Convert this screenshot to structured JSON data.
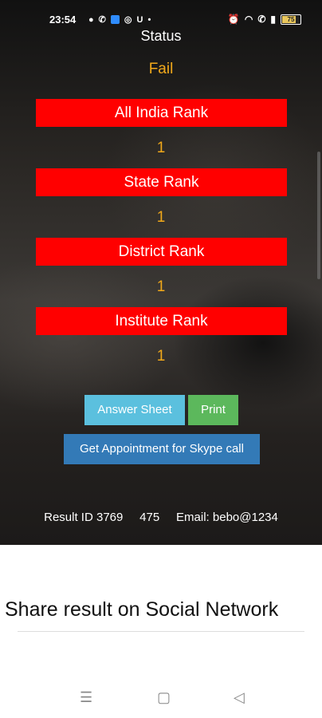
{
  "status_bar": {
    "time": "23:54",
    "left_icons": [
      "notification-dot-icon",
      "whatsapp-icon",
      "app-icon",
      "instagram-icon",
      "u-icon",
      "dot-icon"
    ],
    "battery": "75"
  },
  "result": {
    "status_label": "Status",
    "status_value": "Fail",
    "ranks": [
      {
        "label": "All India Rank",
        "value": "1"
      },
      {
        "label": "State Rank",
        "value": "1"
      },
      {
        "label": "District Rank",
        "value": "1"
      },
      {
        "label": "Institute Rank",
        "value": "1"
      }
    ]
  },
  "buttons": {
    "answer_sheet": "Answer Sheet",
    "print": "Print",
    "skype": "Get Appointment for Skype call"
  },
  "colors": {
    "rank_bar": "#ff0000",
    "rank_value": "#f2a91a",
    "answer_sheet": "#5bc0de",
    "print": "#5cb85c",
    "skype": "#337ab7"
  },
  "footer": {
    "info": "Result ID 3769     475     Email: bebo@1234"
  },
  "share": {
    "title": "Share result on Social Network"
  },
  "nav": {
    "icons": [
      "menu-icon",
      "home-square-icon",
      "back-triangle-icon"
    ]
  }
}
